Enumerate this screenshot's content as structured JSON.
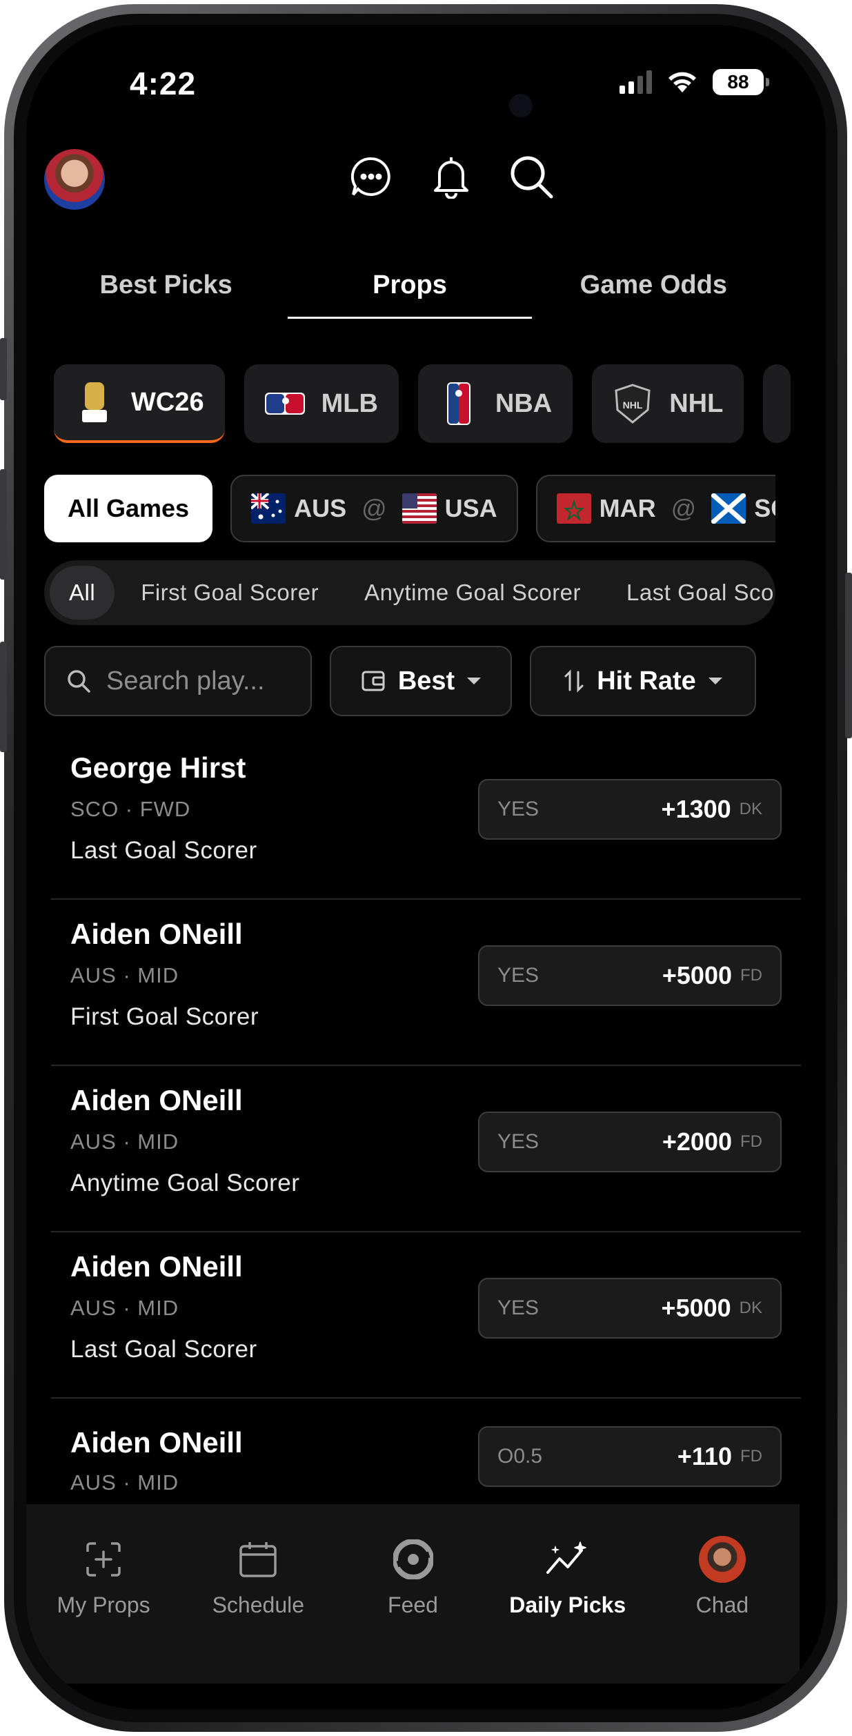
{
  "status_bar": {
    "time": "4:22",
    "battery": "88"
  },
  "header": {
    "avatar_icon": "user-avatar",
    "icons": [
      "chat-icon",
      "bell-icon",
      "search-icon"
    ]
  },
  "tabs": [
    {
      "label": "Best Picks",
      "active": false
    },
    {
      "label": "Props",
      "active": true
    },
    {
      "label": "Game Odds",
      "active": false
    }
  ],
  "leagues": [
    {
      "label": "WC26",
      "icon": "world-cup-trophy-icon",
      "active": true
    },
    {
      "label": "MLB",
      "icon": "mlb-logo-icon",
      "active": false
    },
    {
      "label": "NBA",
      "icon": "nba-logo-icon",
      "active": false
    },
    {
      "label": "NHL",
      "icon": "nhl-logo-icon",
      "active": false
    }
  ],
  "games": {
    "all_label": "All Games",
    "items": [
      {
        "away": "AUS",
        "home": "USA",
        "at": "@"
      },
      {
        "away": "MAR",
        "home": "SCO",
        "at": "@"
      }
    ]
  },
  "markets": [
    "All",
    "First Goal Scorer",
    "Anytime Goal Scorer",
    "Last Goal Scorer"
  ],
  "filters": {
    "search_placeholder": "Search play...",
    "book_label": "Best",
    "sort_label": "Hit Rate"
  },
  "props": [
    {
      "name": "George Hirst",
      "meta": "SCO · FWD",
      "market": "Last Goal Scorer",
      "selection": "YES",
      "price": "+1300",
      "book": "DK"
    },
    {
      "name": "Aiden ONeill",
      "meta": "AUS · MID",
      "market": "First Goal Scorer",
      "selection": "YES",
      "price": "+5000",
      "book": "FD"
    },
    {
      "name": "Aiden ONeill",
      "meta": "AUS · MID",
      "market": "Anytime Goal Scorer",
      "selection": "YES",
      "price": "+2000",
      "book": "FD"
    },
    {
      "name": "Aiden ONeill",
      "meta": "AUS · MID",
      "market": "Last Goal Scorer",
      "selection": "YES",
      "price": "+5000",
      "book": "DK"
    },
    {
      "name": "Aiden ONeill",
      "meta": "AUS · MID",
      "selection": "O0.5",
      "price": "+110",
      "book": "FD"
    }
  ],
  "bottom_nav": [
    {
      "label": "My Props",
      "icon": "add-square-icon",
      "active": false
    },
    {
      "label": "Schedule",
      "icon": "calendar-icon",
      "active": false
    },
    {
      "label": "Feed",
      "icon": "feed-logo-icon",
      "active": false
    },
    {
      "label": "Daily Picks",
      "icon": "trend-sparkle-icon",
      "active": true
    },
    {
      "label": "Chad",
      "icon": "profile-avatar",
      "active": false
    }
  ],
  "colors": {
    "accent": "#ff6a1a",
    "background": "#000000"
  }
}
